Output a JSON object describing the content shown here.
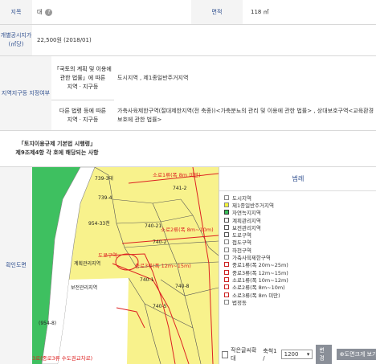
{
  "rows": {
    "jimok": {
      "label": "지목",
      "value": "대",
      "help": "?"
    },
    "area": {
      "label": "면적",
      "value": "118 ㎡"
    },
    "price": {
      "label": "개별공시지가\n(㎡당)",
      "value": "22,500원 (2018/01)"
    },
    "zone": {
      "label": "지역지구등 지정여부",
      "law1_label": "「국토의 계획 및 이용에\n관한 법률」에 따른\n지역ㆍ지구등",
      "law1_value": "도시지역 , 제1종일반주거지역",
      "law2_label": "다른 법령 등에 따른\n지역ㆍ지구등",
      "law2_value": "가축사육제한구역(절대제한지역(전 축종))<가축분뇨의 관리 및 이용에 관한 법률> , 상대보호구역<교육환경 보호에 관한 법률>"
    },
    "enforcement": {
      "label": "「토지이용규제 기본법 시행령」\n제9조제4항 각 호에 해당되는 사항",
      "value": ""
    },
    "map": {
      "label": "확인도면"
    }
  },
  "map_labels": [
    "739-3대",
    "739-4",
    "954-33천",
    "740-21",
    "740-2",
    "740-1",
    "740-8",
    "740-5",
    "741-2",
    "보전관리지역",
    "계획관리지역",
    "(954-8)",
    "소로1류(폭 8m 미만)",
    "소로2류(폭 8m~10m)",
    "도로구역",
    "중로3류(폭 12m~15m)",
    "3로(중로3류 수도권교차로)"
  ],
  "legend": {
    "title": "범례",
    "items": [
      {
        "label": "도시지역",
        "color": "#ffffff",
        "border": "#888888"
      },
      {
        "label": "제1종일반주거지역",
        "color": "#f4f43a",
        "border": "#888888"
      },
      {
        "label": "자연녹지지역",
        "color": "#39c05a",
        "border": "#333333"
      },
      {
        "label": "계획관리지역",
        "color": "#ffffff",
        "border": "#555555"
      },
      {
        "label": "보전관리지역",
        "color": "#ffffff",
        "border": "#555555"
      },
      {
        "label": "도로구역",
        "color": "#ffffff",
        "border": "#555555"
      },
      {
        "label": "접도구역",
        "color": "#ffffff",
        "border": "#888888"
      },
      {
        "label": "하천구역",
        "color": "#ffffff",
        "border": "#888888"
      },
      {
        "label": "가축사육제한구역",
        "color": "#ffffff",
        "border": "#888888"
      },
      {
        "label": "중로1류(폭 20m~25m)",
        "color": "#ffffff",
        "border": "#cc2222"
      },
      {
        "label": "중로3류(폭 12m~15m)",
        "color": "#ffffff",
        "border": "#cc2222"
      },
      {
        "label": "소로1류(폭 10m~12m)",
        "color": "#ffffff",
        "border": "#cc2222"
      },
      {
        "label": "소로2류(폭 8m~10m)",
        "color": "#ffffff",
        "border": "#cc2222"
      },
      {
        "label": "소로3류(폭 8m 미만)",
        "color": "#ffffff",
        "border": "#cc2222"
      },
      {
        "label": "법정동",
        "color": "#ffffff",
        "border": "#888888"
      }
    ]
  },
  "controls": {
    "checkbox_label": "작은글씨확대",
    "scale_label": "축척1 /",
    "scale_value": "1200",
    "change_button": "변경",
    "zoom_button": "도면크게 보기"
  }
}
